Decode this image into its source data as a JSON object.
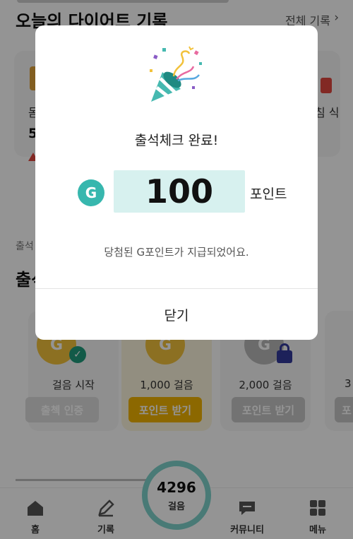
{
  "background": {
    "diet_section": {
      "title": "오늘의 다이어트 기록",
      "all_link": "전체 기록",
      "chevron": "›",
      "left_card_label": "몸",
      "left_card_value": "5",
      "right_card_label": "침 식"
    },
    "attendance": {
      "sub_label": "출석",
      "title": "출석"
    },
    "steps": [
      {
        "label": "걸음 시작",
        "button": "출첵 인증",
        "state": "done"
      },
      {
        "label": "1,000 걸음",
        "button": "포인트 받기",
        "state": "active"
      },
      {
        "label": "2,000 걸음",
        "button": "포인트 받기",
        "state": "locked"
      },
      {
        "label": "3",
        "button": "포",
        "state": "locked"
      }
    ],
    "tabbar": {
      "home": "홈",
      "record": "기록",
      "steps_count": "4296",
      "steps_unit": "걸음",
      "community": "커뮤니티",
      "menu": "메뉴"
    }
  },
  "modal": {
    "title": "출석체크 완료!",
    "g_letter": "G",
    "amount": "100",
    "unit": "포인트",
    "message": "당첨된 G포인트가 지급되었어요.",
    "close_label": "닫기"
  },
  "colors": {
    "teal": "#37b7ae",
    "amount_bg": "#d7f1ef",
    "gold": "#f2b400",
    "overlay": "rgba(0,0,0,0.42)"
  }
}
